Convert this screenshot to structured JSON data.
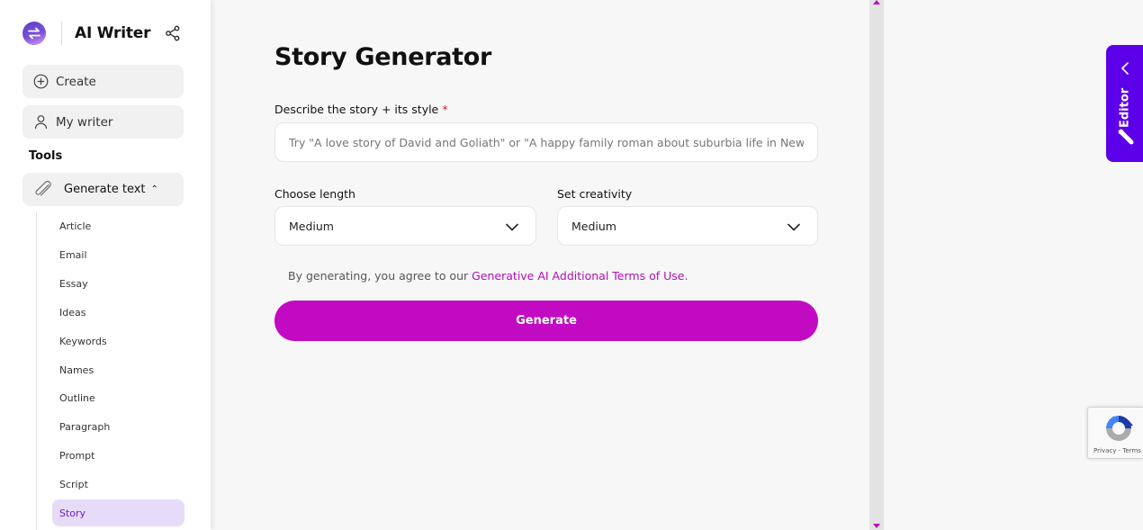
{
  "app": {
    "title": "AI Writer",
    "icons": {
      "logo": "swap-arrows-icon",
      "share": "share-icon"
    }
  },
  "sidebar": {
    "create_label": "Create",
    "my_writer_label": "My writer",
    "tools_heading": "Tools",
    "generate_text_label": "Generate text",
    "generate_text_expanded": true,
    "sub_items": [
      {
        "label": "Article",
        "active": false
      },
      {
        "label": "Email",
        "active": false
      },
      {
        "label": "Essay",
        "active": false
      },
      {
        "label": "Ideas",
        "active": false
      },
      {
        "label": "Keywords",
        "active": false
      },
      {
        "label": "Names",
        "active": false
      },
      {
        "label": "Outline",
        "active": false
      },
      {
        "label": "Paragraph",
        "active": false
      },
      {
        "label": "Prompt",
        "active": false
      },
      {
        "label": "Script",
        "active": false
      },
      {
        "label": "Story",
        "active": true
      }
    ]
  },
  "main": {
    "title": "Story Generator",
    "describe": {
      "label": "Describe the story + its style",
      "required_mark": "*",
      "value": "",
      "placeholder": "Try \"A love story of David and Goliath\" or \"A happy family roman about suburbia life in New York"
    },
    "length": {
      "label": "Choose length",
      "value": "Medium"
    },
    "creativity": {
      "label": "Set creativity",
      "value": "Medium"
    },
    "terms": {
      "prefix": "By generating, you agree to our ",
      "link": "Generative AI Additional Terms of Use."
    },
    "generate_label": "Generate"
  },
  "editor_tab": {
    "label": "Editor"
  },
  "recaptcha": {
    "text": "Privacy - Terms"
  },
  "colors": {
    "accent": "#c10ac1",
    "editor_tab": "#5d00ea",
    "active_item_bg": "#e6dcf9",
    "active_item_text": "#6a1fd0",
    "required": "#e0182d"
  }
}
